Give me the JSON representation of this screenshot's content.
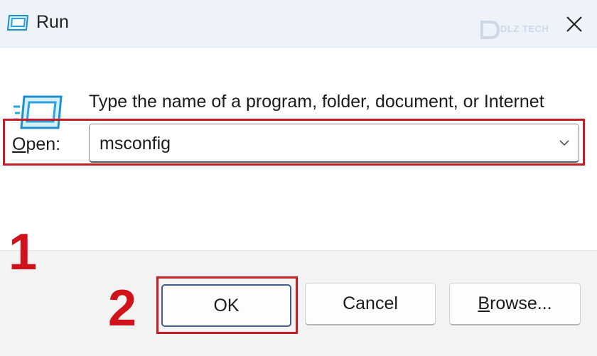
{
  "window": {
    "title": "Run",
    "close_icon": "close-icon"
  },
  "watermark": {
    "text": "DLZ TECH"
  },
  "description": "Type the name of a program, folder, document, or Internet resource, and Windows will open it for you.",
  "open": {
    "label_prefix": "O",
    "label_rest": "pen:",
    "value": "msconfig",
    "dropdown_icon": "chevron-down-icon"
  },
  "buttons": {
    "ok": "OK",
    "cancel": "Cancel",
    "browse_prefix": "B",
    "browse_rest": "rowse..."
  },
  "annotations": {
    "step1": "1",
    "step2": "2"
  },
  "colors": {
    "annotation_red": "#c41e24",
    "titlebar_bg": "#eef2f9",
    "footer_bg": "#f3f3f3",
    "icon_blue": "#2aa3e0"
  }
}
